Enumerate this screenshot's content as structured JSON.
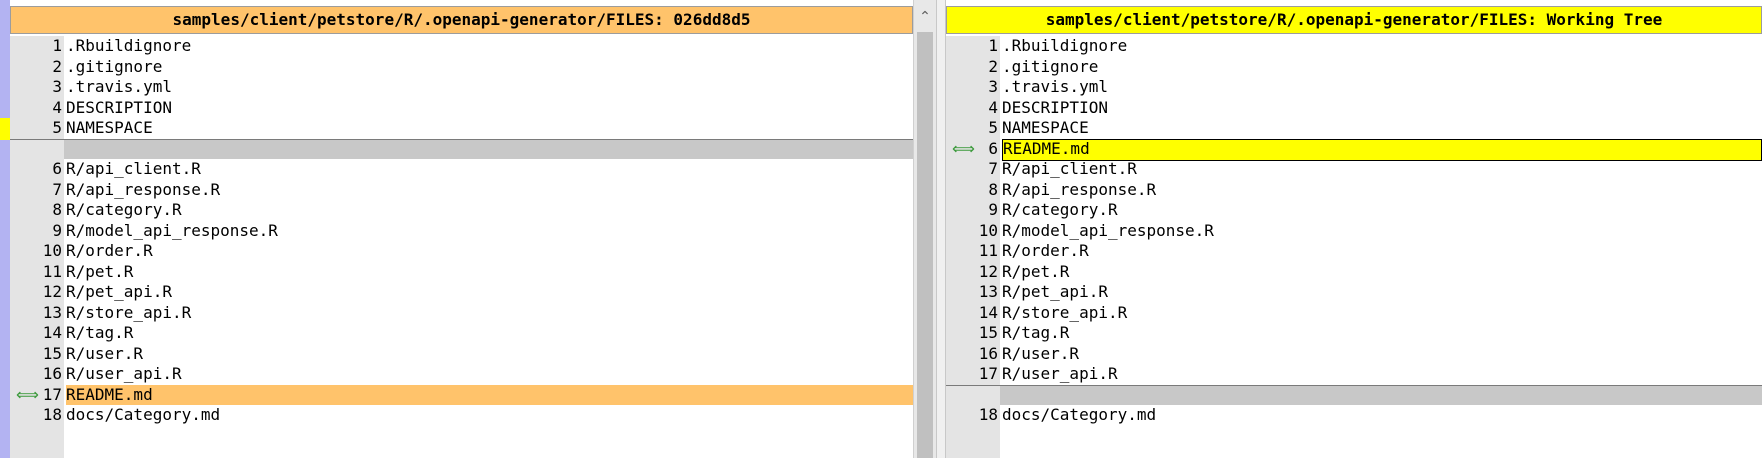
{
  "left_pane": {
    "title": "samples/client/petstore/R/.openapi-generator/FILES: 026dd8d5",
    "scroll_up_icon": "chevron-up-icon",
    "lines": [
      {
        "num": "1",
        "text": ".Rbuildignore"
      },
      {
        "num": "2",
        "text": ".gitignore"
      },
      {
        "num": "3",
        "text": ".travis.yml"
      },
      {
        "num": "4",
        "text": "DESCRIPTION"
      },
      {
        "num": "5",
        "text": "NAMESPACE"
      },
      {
        "num": "",
        "text": "",
        "phantom": true
      },
      {
        "num": "6",
        "text": "R/api_client.R"
      },
      {
        "num": "7",
        "text": "R/api_response.R"
      },
      {
        "num": "8",
        "text": "R/category.R"
      },
      {
        "num": "9",
        "text": "R/model_api_response.R"
      },
      {
        "num": "10",
        "text": "R/order.R"
      },
      {
        "num": "11",
        "text": "R/pet.R"
      },
      {
        "num": "12",
        "text": "R/pet_api.R"
      },
      {
        "num": "13",
        "text": "R/store_api.R"
      },
      {
        "num": "14",
        "text": "R/tag.R"
      },
      {
        "num": "15",
        "text": "R/user.R"
      },
      {
        "num": "16",
        "text": "R/user_api.R"
      },
      {
        "num": "17",
        "text": "README.md",
        "changed": true,
        "arrow": "⟺"
      },
      {
        "num": "18",
        "text": "docs/Category.md"
      }
    ]
  },
  "right_pane": {
    "title": "samples/client/petstore/R/.openapi-generator/FILES: Working Tree",
    "lines": [
      {
        "num": "1",
        "text": ".Rbuildignore"
      },
      {
        "num": "2",
        "text": ".gitignore"
      },
      {
        "num": "3",
        "text": ".travis.yml"
      },
      {
        "num": "4",
        "text": "DESCRIPTION"
      },
      {
        "num": "5",
        "text": "NAMESPACE"
      },
      {
        "num": "6",
        "text": "README.md",
        "changed": true,
        "arrow": "⟺"
      },
      {
        "num": "7",
        "text": "R/api_client.R"
      },
      {
        "num": "8",
        "text": "R/api_response.R"
      },
      {
        "num": "9",
        "text": "R/category.R"
      },
      {
        "num": "10",
        "text": "R/model_api_response.R"
      },
      {
        "num": "11",
        "text": "R/order.R"
      },
      {
        "num": "12",
        "text": "R/pet.R"
      },
      {
        "num": "13",
        "text": "R/pet_api.R"
      },
      {
        "num": "14",
        "text": "R/store_api.R"
      },
      {
        "num": "15",
        "text": "R/tag.R"
      },
      {
        "num": "16",
        "text": "R/user.R"
      },
      {
        "num": "17",
        "text": "R/user_api.R"
      },
      {
        "num": "",
        "text": "",
        "phantom": true
      },
      {
        "num": "18",
        "text": "docs/Category.md"
      }
    ]
  },
  "colors": {
    "left_changed": "#ffc36b",
    "right_changed": "#ffff00",
    "phantom": "#c8c8c8",
    "location_strip": "#b3b3f2",
    "arrow": "#3c9a3c"
  }
}
